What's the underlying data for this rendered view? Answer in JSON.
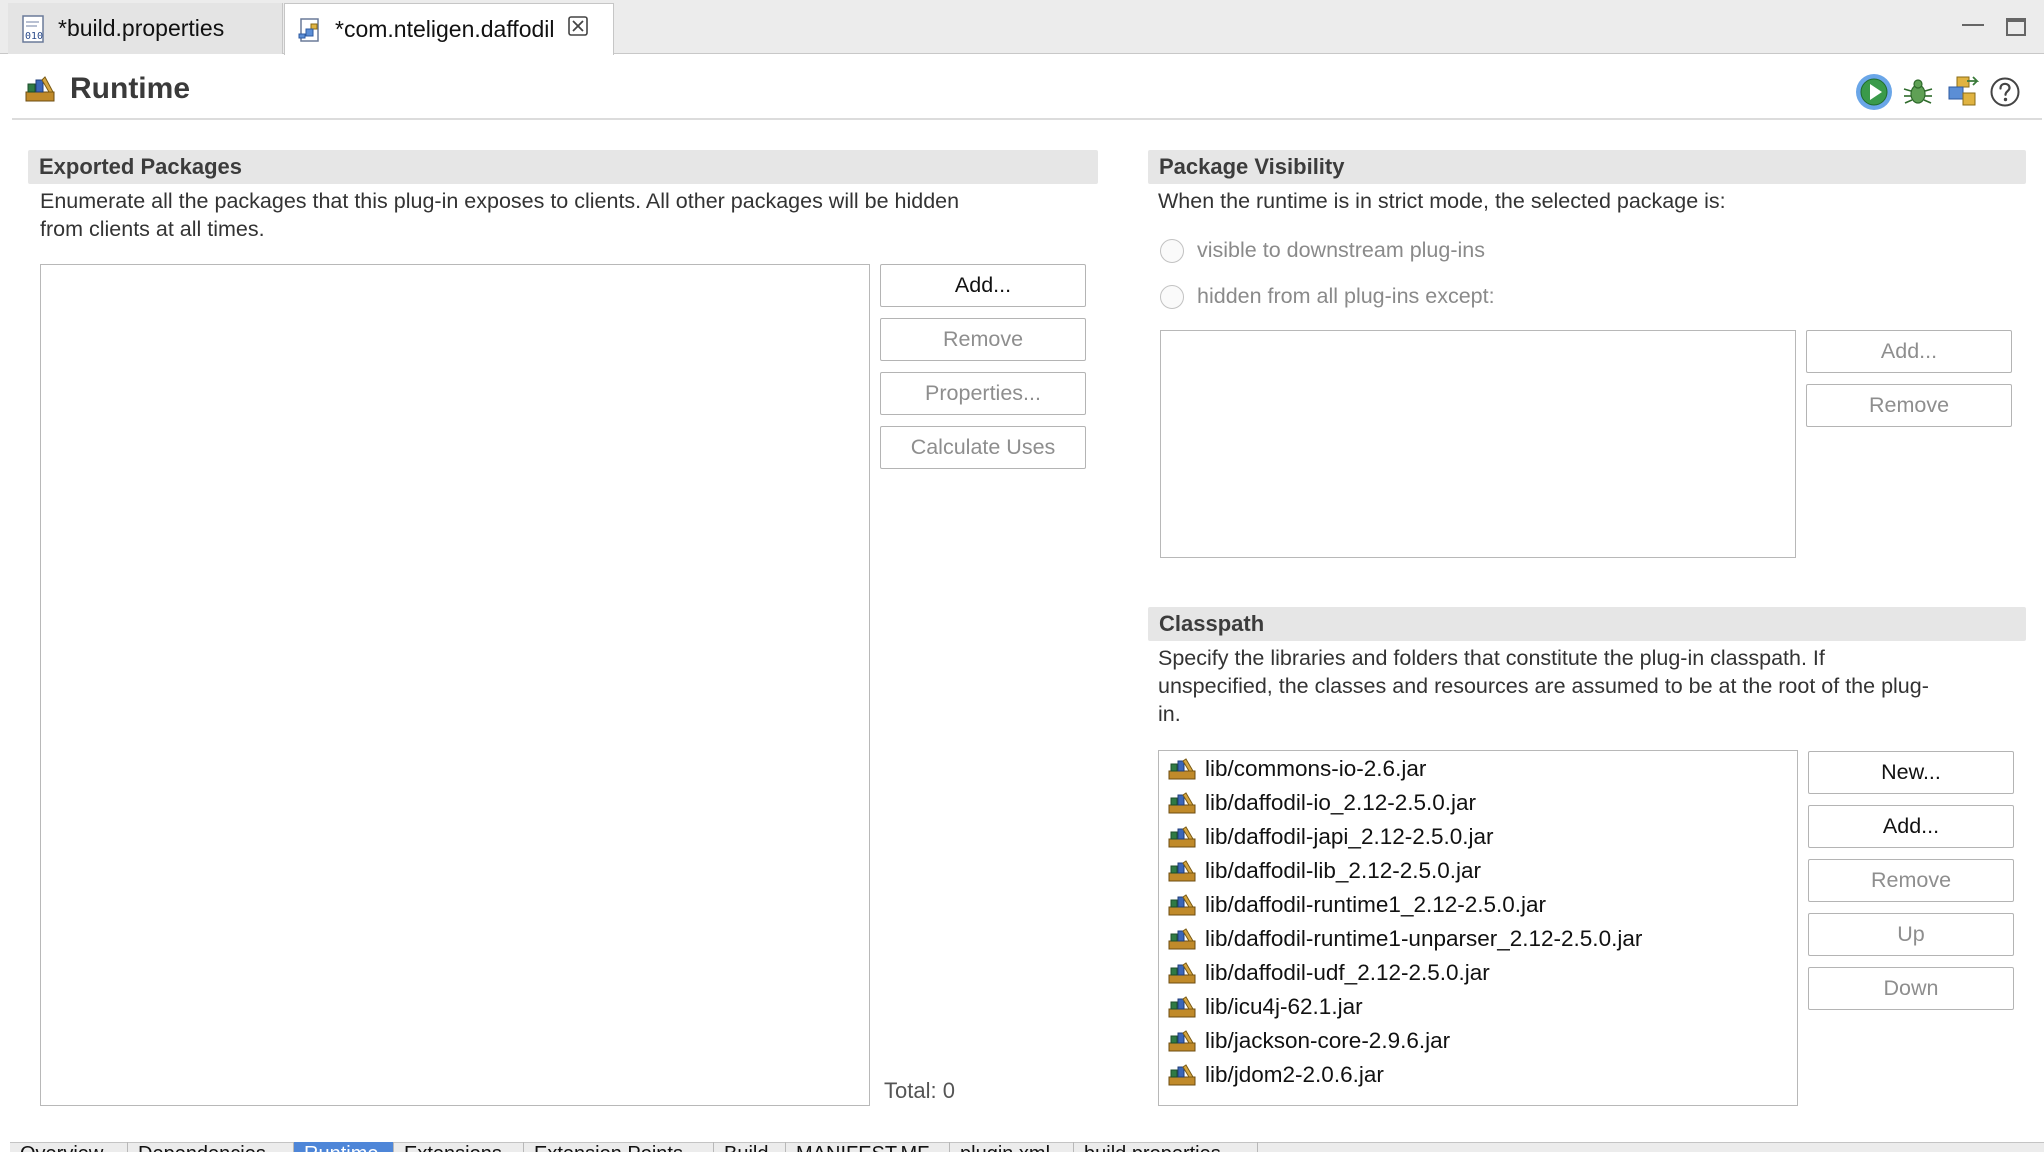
{
  "tabs": [
    {
      "label": "*build.properties",
      "icon": "properties-file-icon",
      "active": false
    },
    {
      "label": "*com.nteligen.daffodil",
      "icon": "plugin-manifest-icon",
      "active": true
    }
  ],
  "form": {
    "title": "Runtime",
    "icon": "runtime-library-icon",
    "toolbar_icons": [
      "run-icon",
      "debug-icon",
      "export-icon",
      "help-icon"
    ]
  },
  "exported_packages": {
    "heading": "Exported Packages",
    "description_line1": "Enumerate all the packages that this plug-in exposes to clients.  All other packages will be hidden",
    "description_line2": "from clients at all times.",
    "buttons": {
      "add": "Add...",
      "remove": "Remove",
      "properties": "Properties...",
      "calculate_uses": "Calculate Uses"
    },
    "total_label": "Total: 0"
  },
  "package_visibility": {
    "heading": "Package Visibility",
    "description": "When the runtime is in strict mode, the selected package is:",
    "option_visible": "visible to downstream plug-ins",
    "option_hidden": "hidden from all plug-ins except:",
    "buttons": {
      "add": "Add...",
      "remove": "Remove"
    }
  },
  "classpath": {
    "heading": "Classpath",
    "description_line1": "Specify the libraries and folders that constitute the plug-in classpath.  If",
    "description_line2": "unspecified, the classes and resources are assumed to be at the root of the plug-",
    "description_line3": "in.",
    "items": [
      "lib/commons-io-2.6.jar",
      "lib/daffodil-io_2.12-2.5.0.jar",
      "lib/daffodil-japi_2.12-2.5.0.jar",
      "lib/daffodil-lib_2.12-2.5.0.jar",
      "lib/daffodil-runtime1_2.12-2.5.0.jar",
      "lib/daffodil-runtime1-unparser_2.12-2.5.0.jar",
      "lib/daffodil-udf_2.12-2.5.0.jar",
      "lib/icu4j-62.1.jar",
      "lib/jackson-core-2.9.6.jar",
      "lib/jdom2-2.0.6.jar"
    ],
    "buttons": {
      "new": "New...",
      "add": "Add...",
      "remove": "Remove",
      "up": "Up",
      "down": "Down"
    }
  },
  "page_tabs": [
    "Overview",
    "Dependencies",
    "Runtime",
    "Extensions",
    "Extension Points",
    "Build",
    "MANIFEST.MF",
    "plugin.xml",
    "build.properties"
  ],
  "colors": {
    "accent": "#4e86d8",
    "section_bg": "#e6e6e6",
    "disabled_text": "#8e8e8e"
  }
}
